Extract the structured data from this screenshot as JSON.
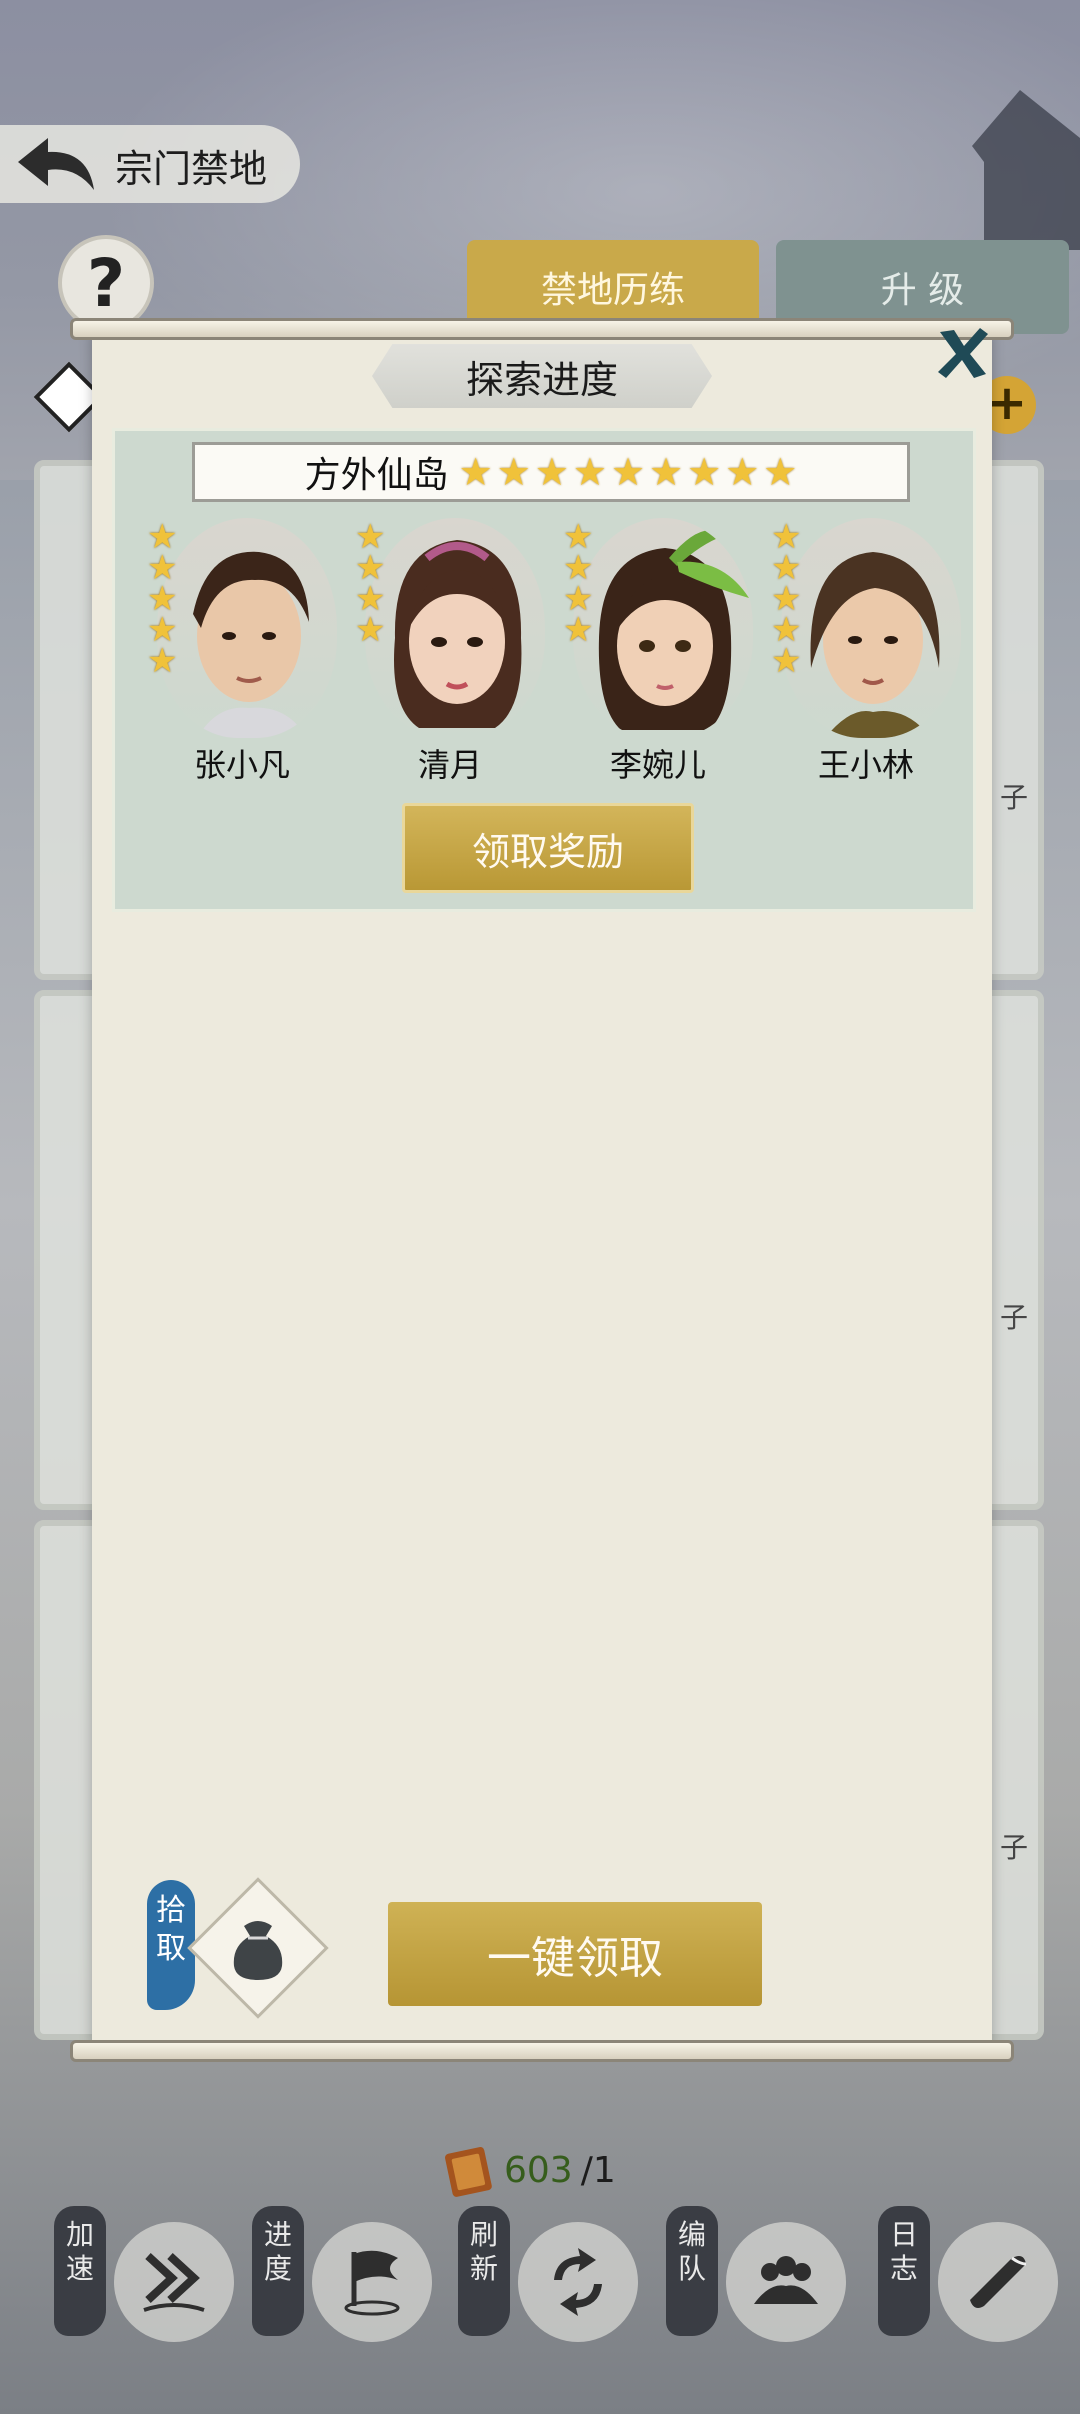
{
  "header": {
    "title": "宗门禁地",
    "help_label": "?"
  },
  "tabs": [
    {
      "label": "禁地历练",
      "active": true
    },
    {
      "label": "升 级",
      "active": false
    }
  ],
  "background_panels": [
    {
      "label": "子"
    },
    {
      "label": "子"
    },
    {
      "label": "子"
    }
  ],
  "plus_label": "+",
  "modal": {
    "title": "探索进度",
    "card": {
      "location": "方外仙岛",
      "location_stars": 9,
      "heroes": [
        {
          "name": "张小凡",
          "stars": 5
        },
        {
          "name": "清月",
          "stars": 4
        },
        {
          "name": "李婉儿",
          "stars": 4
        },
        {
          "name": "王小林",
          "stars": 5
        }
      ],
      "claim_reward_label": "领取奖励"
    },
    "pickup_label": "拾取",
    "claim_all_label": "一键领取"
  },
  "resource": {
    "value": "603",
    "max": "/1"
  },
  "actions": [
    {
      "label": "加速",
      "icon": "fast-forward-icon"
    },
    {
      "label": "进度",
      "icon": "flag-icon"
    },
    {
      "label": "刷新",
      "icon": "refresh-icon"
    },
    {
      "label": "编队",
      "icon": "team-icon"
    },
    {
      "label": "日志",
      "icon": "scroll-icon"
    }
  ],
  "colors": {
    "gold": "#c9a94a",
    "star": "#f0c23a",
    "paper": "#edeadd",
    "card": "#cdd9cf"
  }
}
